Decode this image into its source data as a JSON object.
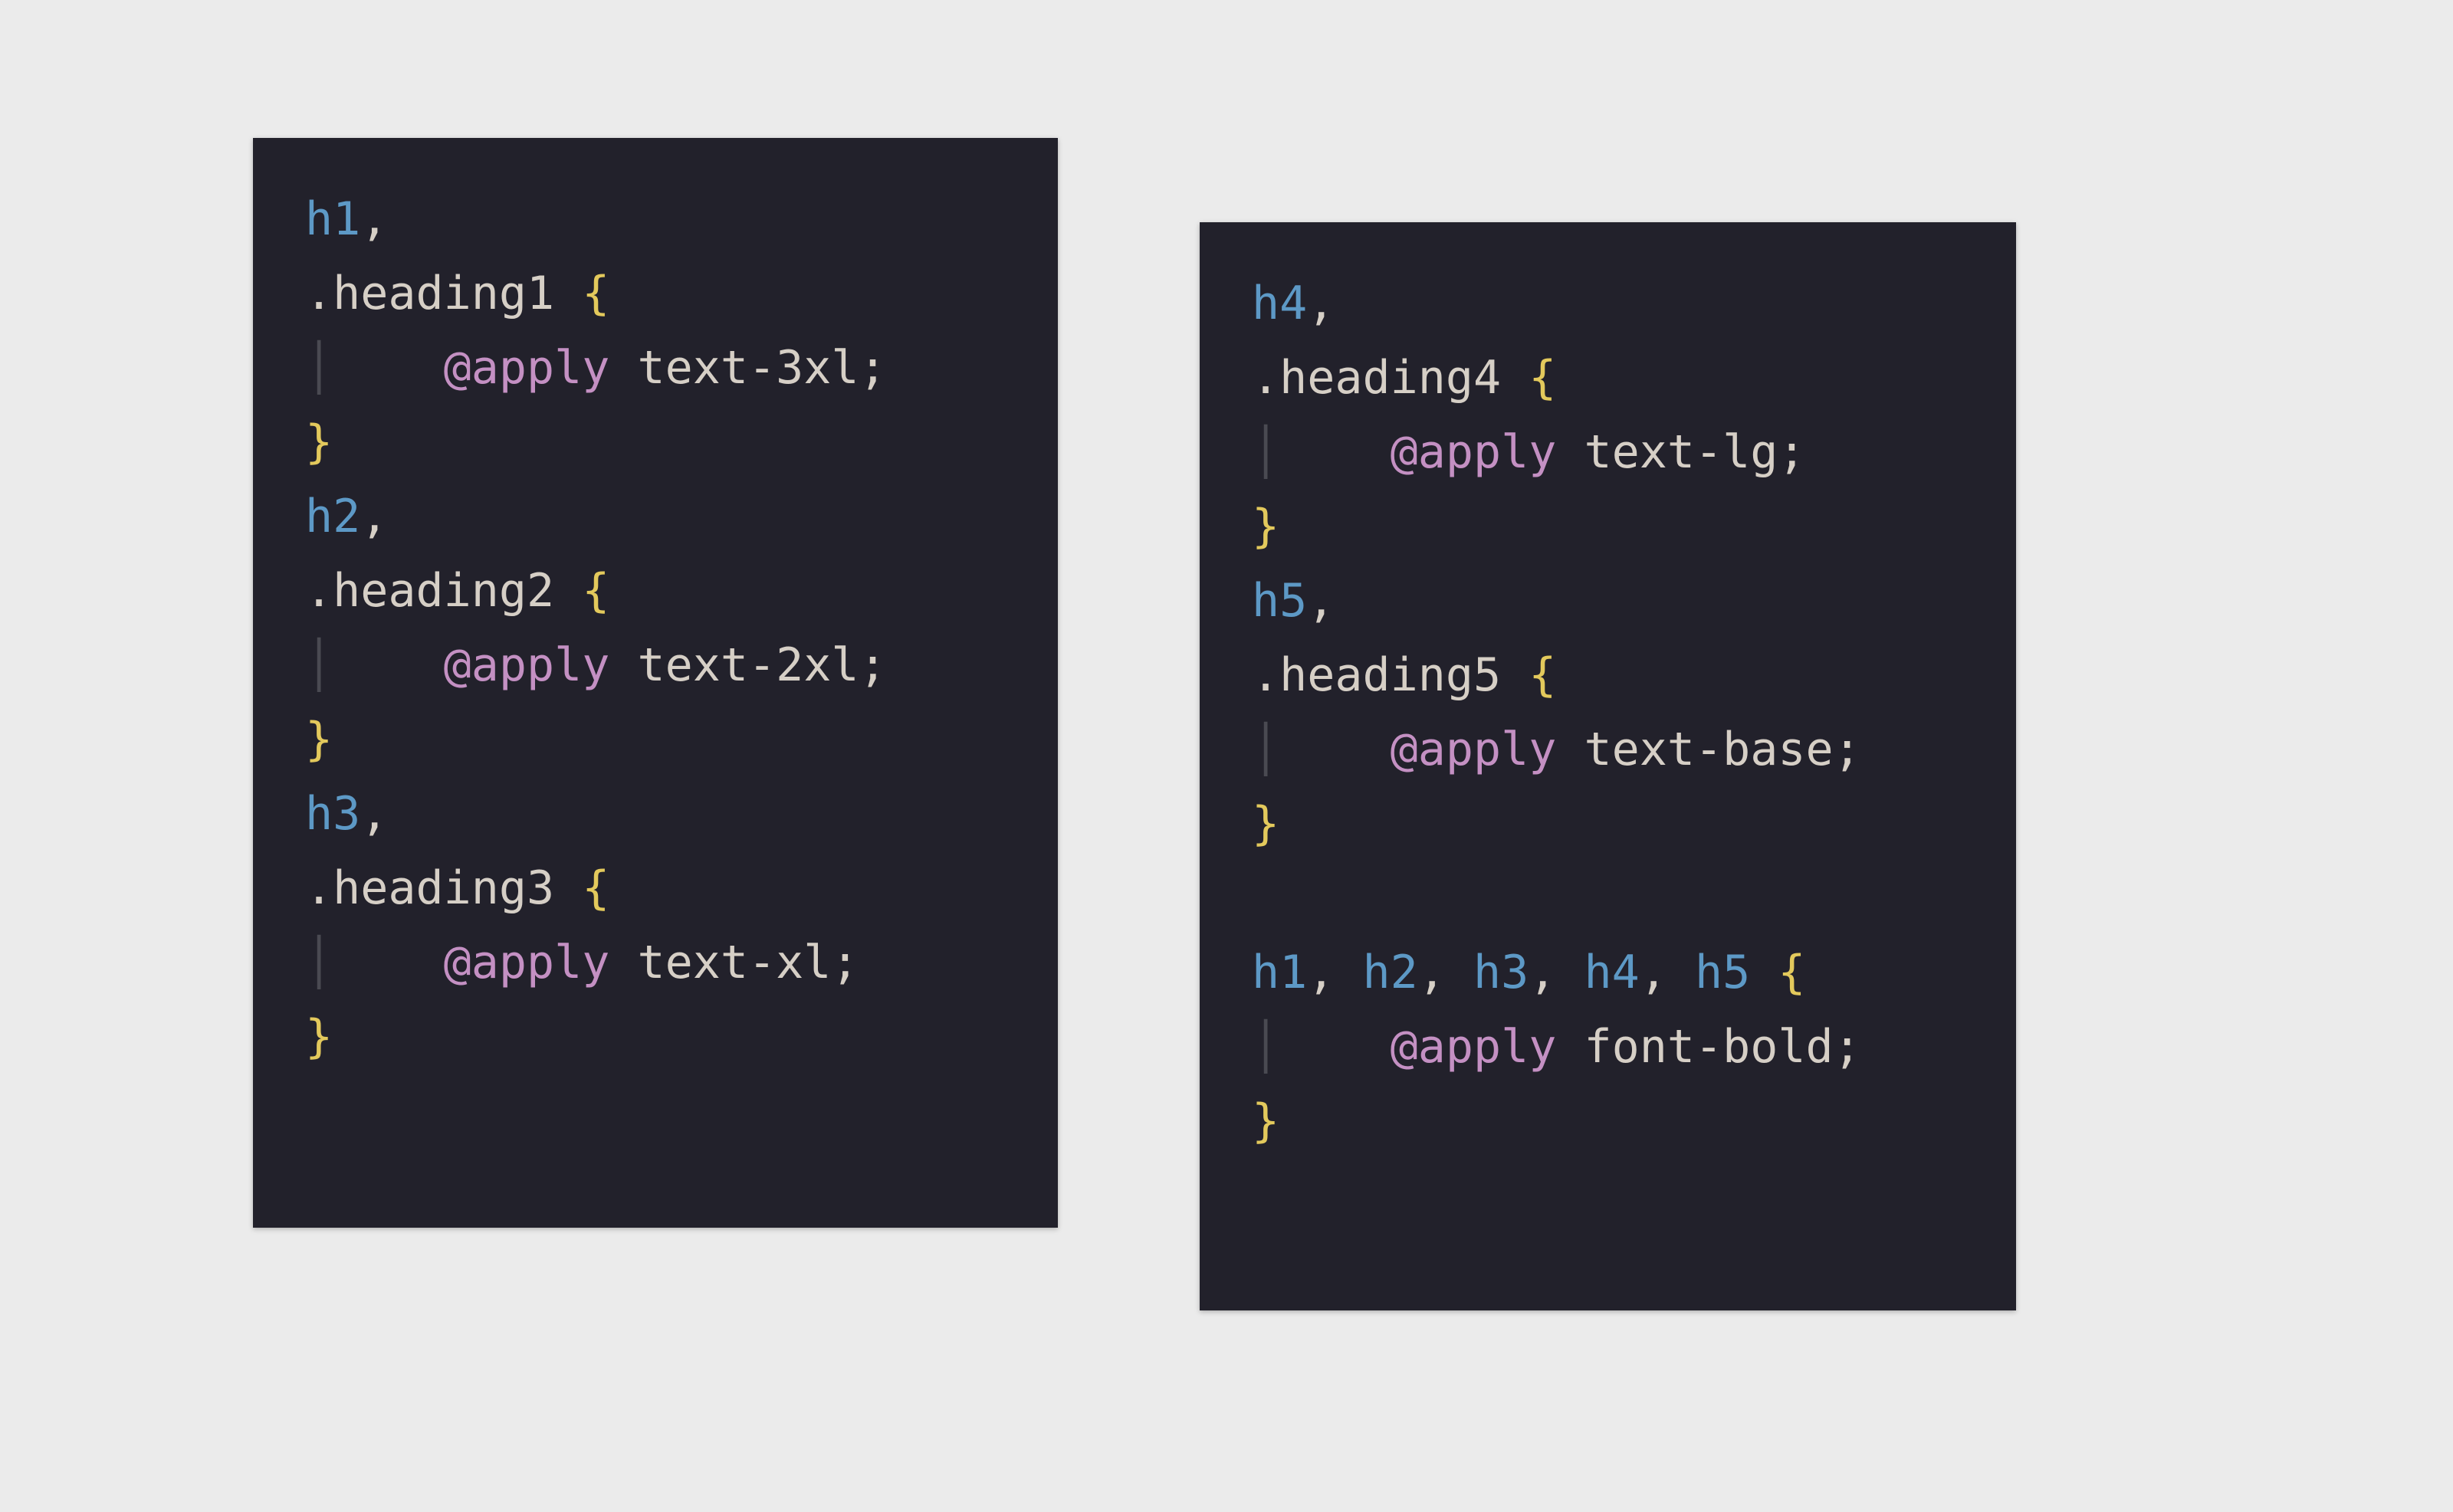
{
  "colors": {
    "page_bg": "#ebebeb",
    "block_bg": "#22212b",
    "selector": "#5d99c6",
    "brace": "#e3c95c",
    "apply": "#c490c3",
    "text": "#d6cfc6",
    "guide": "#4a4a52"
  },
  "left": {
    "t0": "h1",
    "c0": ",",
    "t1": ".heading1",
    "b1o": " {",
    "i1": "│",
    "a1": "    @apply",
    "u1": " text-3xl",
    "s1": ";",
    "b1c": "}",
    "t2": "h2",
    "c2": ",",
    "t3": ".heading2",
    "b3o": " {",
    "i3": "│",
    "a3": "    @apply",
    "u3": " text-2xl",
    "s3": ";",
    "b3c": "}",
    "t4": "h3",
    "c4": ",",
    "t5": ".heading3",
    "b5o": " {",
    "i5": "│",
    "a5": "    @apply",
    "u5": " text-xl",
    "s5": ";",
    "b5c": "}"
  },
  "right": {
    "t0": "h4",
    "c0": ",",
    "t1": ".heading4",
    "b1o": " {",
    "i1": "│",
    "a1": "    @apply",
    "u1": " text-lg",
    "s1": ";",
    "b1c": "}",
    "t2": "h5",
    "c2": ",",
    "t3": ".heading5",
    "b3o": " {",
    "i3": "│",
    "a3": "    @apply",
    "u3": " text-base",
    "s3": ";",
    "b3c": "}",
    "t4": "h1",
    "c4": ", ",
    "t5": "h2",
    "c5": ", ",
    "t6": "h3",
    "c6": ", ",
    "t7": "h4",
    "c7": ", ",
    "t8": "h5",
    "b8o": " {",
    "i8": "│",
    "a8": "    @apply",
    "u8": " font-bold",
    "s8": ";",
    "b8c": "}"
  }
}
